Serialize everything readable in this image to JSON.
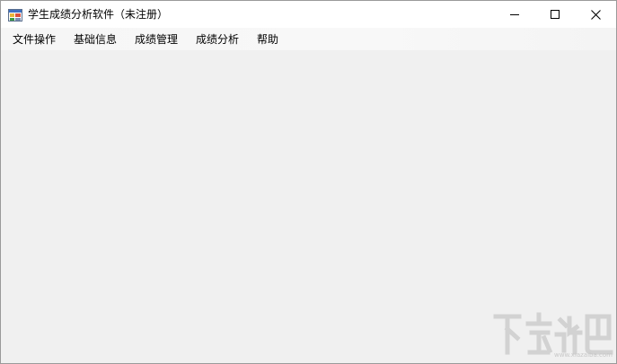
{
  "window": {
    "title": "学生成绩分析软件（未注册）",
    "icon": "app-window-icon"
  },
  "caption_buttons": {
    "minimize_icon": "minimize-icon",
    "maximize_icon": "maximize-icon",
    "close_icon": "close-icon"
  },
  "menu": {
    "items": [
      {
        "label": "文件操作"
      },
      {
        "label": "基础信息"
      },
      {
        "label": "成绩管理"
      },
      {
        "label": "成绩分析"
      },
      {
        "label": "帮助"
      }
    ]
  },
  "watermark": {
    "url": "www.xiazaiba.com"
  },
  "colors": {
    "client_background": "#f0f0f0",
    "titlebar_background": "#ffffff",
    "text": "#000000"
  }
}
